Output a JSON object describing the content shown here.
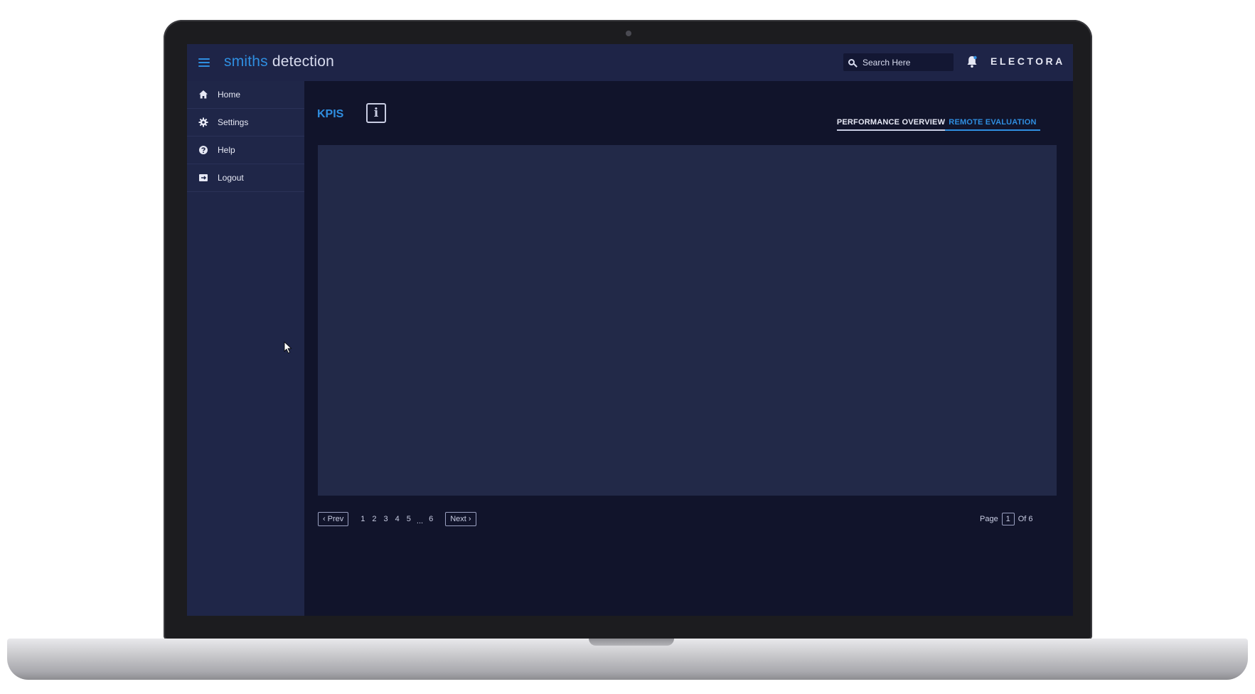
{
  "header": {
    "brand_primary": "smiths",
    "brand_secondary": "detection",
    "search_placeholder": "Search Here",
    "app_name": "ELECTORA"
  },
  "sidebar": {
    "items": [
      {
        "label": "Home",
        "icon": "home-icon"
      },
      {
        "label": "Settings",
        "icon": "gear-icon"
      },
      {
        "label": "Help",
        "icon": "help-icon"
      },
      {
        "label": "Logout",
        "icon": "logout-icon"
      }
    ]
  },
  "main": {
    "title": "KPIS",
    "info_glyph": "i",
    "tabs": [
      {
        "label": "PERFORMANCE OVERVIEW",
        "active": false
      },
      {
        "label": "REMOTE EVALUATION",
        "active": true
      }
    ]
  },
  "pagination": {
    "prev_label": "Prev",
    "next_label": "Next",
    "pages": [
      "1",
      "2",
      "3",
      "4",
      "5"
    ],
    "ellipsis": "...",
    "last_page": "6",
    "page_label": "Page",
    "current_page": "1",
    "of_label": "Of 6"
  },
  "colors": {
    "accent": "#2f8ee0",
    "topbar": "#1e2447",
    "sidebar": "#1f2648",
    "background": "#11142b",
    "panel": "#222948"
  }
}
